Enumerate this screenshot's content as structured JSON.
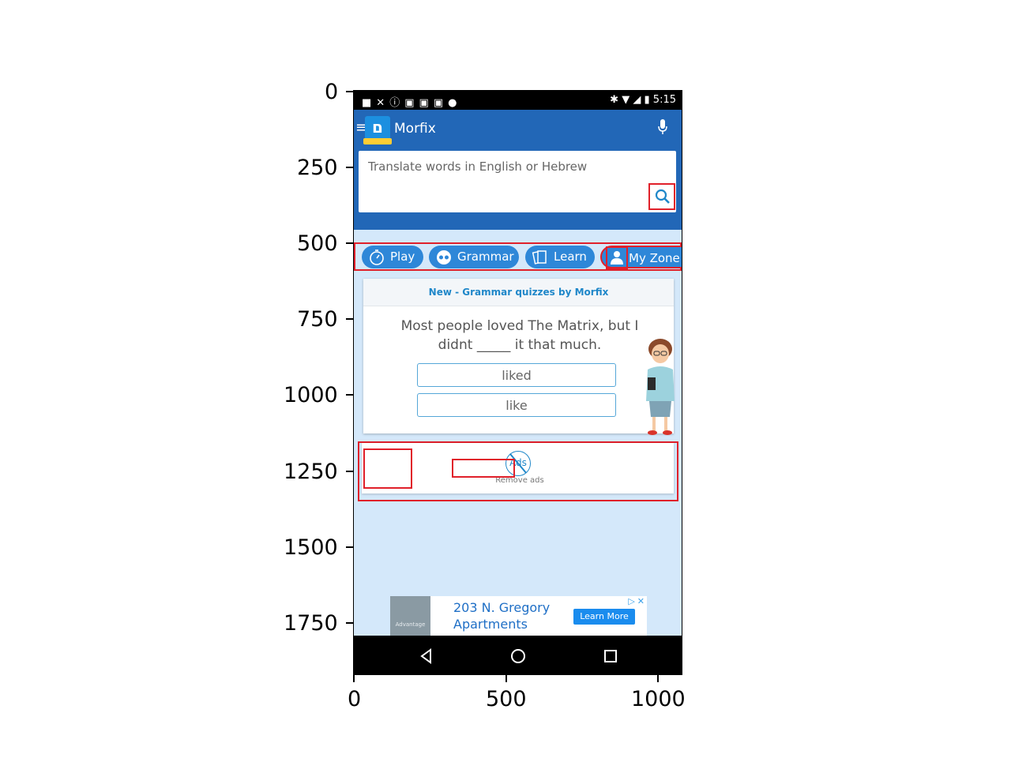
{
  "axis": {
    "y_ticks": [
      "0",
      "250",
      "500",
      "750",
      "1000",
      "1250",
      "1500",
      "1750"
    ],
    "x_ticks": [
      "0",
      "500",
      "1000"
    ]
  },
  "status_bar": {
    "time": "5:15",
    "left_icons": [
      "facebook-icon",
      "satellite-icon",
      "info-icon",
      "lock-icon",
      "briefcase-check-icon",
      "shopping-bag-icon",
      "android-icon"
    ],
    "right_icons": [
      "bluetooth-icon",
      "wifi-icon",
      "no-signal-icon",
      "battery-icon"
    ]
  },
  "app_bar": {
    "title": "Morfix",
    "logo_icon": "morfix-logo-icon",
    "menu_icon": "hamburger-icon",
    "mic_icon": "microphone-icon"
  },
  "search": {
    "placeholder": "Translate words in English or Hebrew",
    "button_icon": "search-icon"
  },
  "tabs": [
    {
      "label": "Play",
      "icon": "stopwatch-icon"
    },
    {
      "label": "Grammar",
      "icon": "glasses-face-icon"
    },
    {
      "label": "Learn",
      "icon": "flashcards-icon"
    },
    {
      "label": "My Zone",
      "icon": "user-icon"
    }
  ],
  "quiz": {
    "header": "New - Grammar quizzes by Morfix",
    "question": "Most people loved The Matrix, but I didnt _____ it that much.",
    "answers": [
      "liked",
      "like"
    ]
  },
  "ads_box": {
    "ads_badge": "Ads",
    "remove_label": "Remove ads"
  },
  "banner": {
    "title_line1": "203 N. Gregory",
    "title_line2": "Apartments",
    "cta": "Learn More",
    "thumb_text": "Advantage Properties LC"
  },
  "colors": {
    "app_blue": "#2267b7",
    "tab_blue": "#2e87d8",
    "page_bg": "#d4e8fa",
    "highlight": "#e0202a"
  }
}
